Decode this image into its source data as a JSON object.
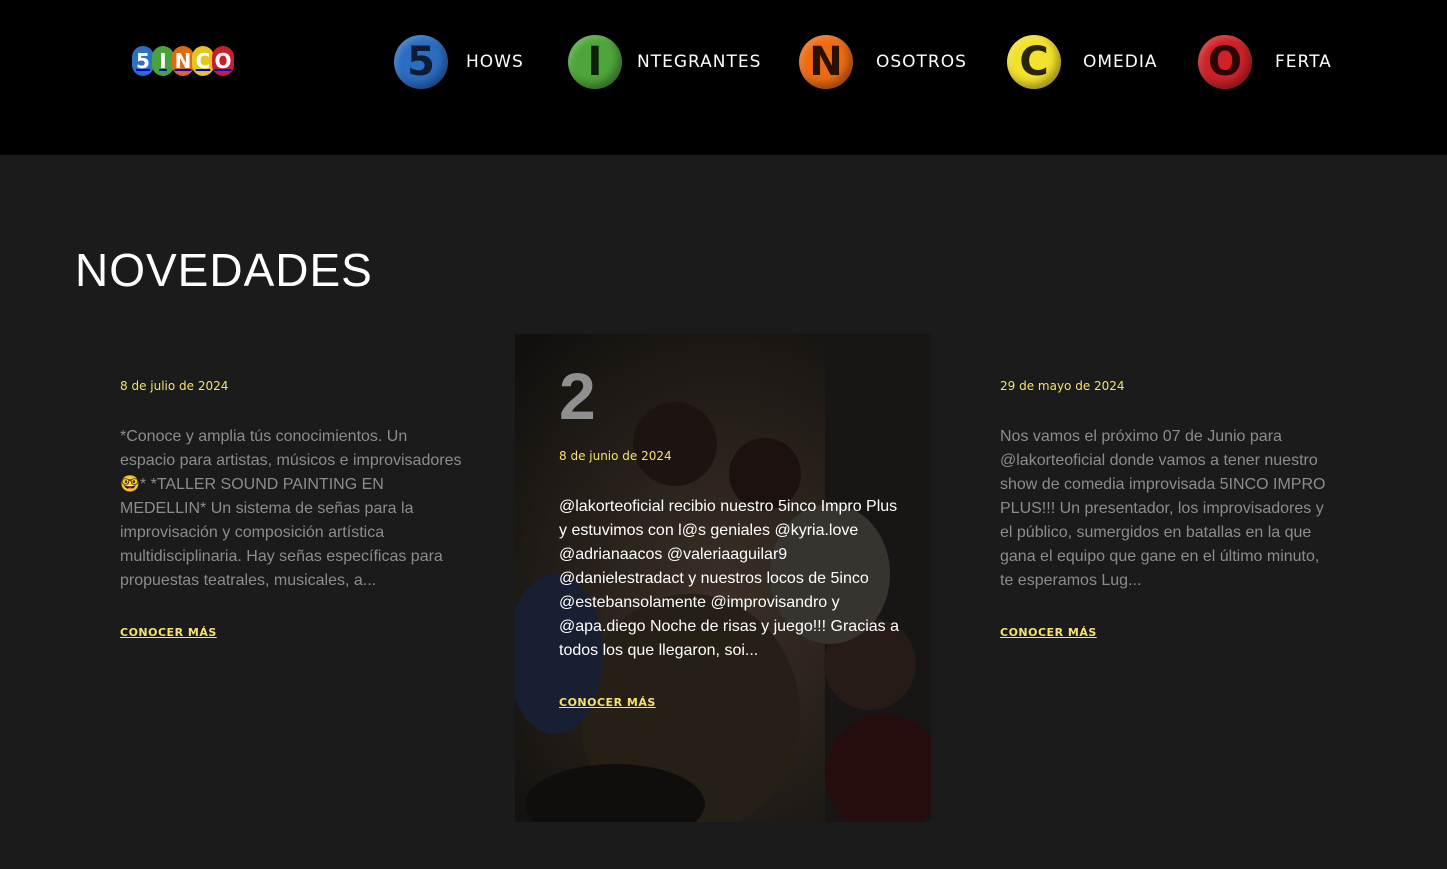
{
  "logo": {
    "letters": [
      "5",
      "I",
      "N",
      "C",
      "O"
    ],
    "colors": [
      "#2d6fc2",
      "#4aa23c",
      "#e06a10",
      "#e6c51d",
      "#c8202a"
    ]
  },
  "nav": [
    {
      "letter": "5",
      "label": "HOWS",
      "color": "#2b6dc1",
      "text": "#0c1c33"
    },
    {
      "letter": "I",
      "label": "NTEGRANTES",
      "color": "#4ea63a",
      "text": "#0d1f0b"
    },
    {
      "letter": "N",
      "label": "OSOTROS",
      "color": "#ee6b12",
      "text": "#2a1002"
    },
    {
      "letter": "C",
      "label": "OMEDIA",
      "color": "#f3e12c",
      "text": "#2a2504"
    },
    {
      "letter": "O",
      "label": "FERTA",
      "color": "#cf2228",
      "text": "#2c0405"
    }
  ],
  "section_title": "NOVEDADES",
  "posts": [
    {
      "date": "8 de julio de 2024",
      "excerpt": "*Conoce y amplia tús conocimientos. Un espacio para artistas, músicos e improvisadores🤓* *TALLER SOUND PAINTING EN MEDELLIN* Un sistema de señas para la improvisación y composición artística multidisciplinaria. Hay señas específicas para propuestas teatrales, musicales, a...",
      "more": "CONOCER MÁS"
    },
    {
      "number": "2",
      "date": "8 de junio de 2024",
      "excerpt": "@lakorteoficial recibio nuestro 5inco Impro Plus y estuvimos con l@s geniales @kyria.love @adrianaacos @valeriaaguilar9 @danielestradact y nuestros locos de 5inco @estebansolamente @improvisandro y @apa.diego Noche de risas y juego!!! Gracias a todos los que llegaron, soi...",
      "more": "CONOCER MÁS"
    },
    {
      "date": "29 de mayo de 2024",
      "excerpt": "Nos vamos el próximo 07 de Junio para @lakorteoficial donde vamos a tener nuestro show de comedia improvisada 5INCO IMPRO PLUS!!! Un presentador, los improvisadores y el público, sumergidos en batallas en la que gana el equipo que gane en el último minuto, te esperamos Lug...",
      "more": "CONOCER MÁS"
    }
  ]
}
